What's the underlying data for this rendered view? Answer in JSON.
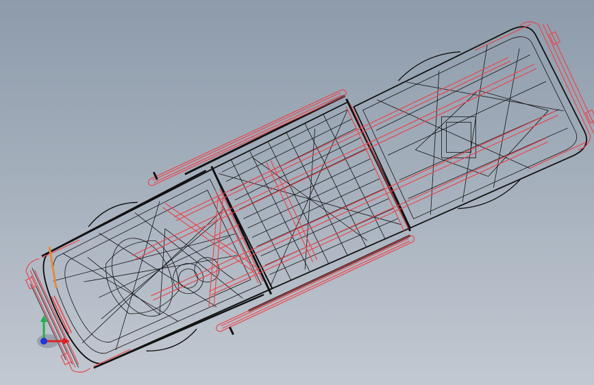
{
  "viewport": {
    "background_top": "#8d9bab",
    "background_bottom": "#c3c9d2",
    "wire_color": "#111111",
    "frame_color": "#e8474c"
  },
  "model": {
    "icon": "vehicle-chassis-wireframe-icon"
  },
  "triad": {
    "x_color": "#e02020",
    "y_color": "#22b04a",
    "z_color": "#2036d8",
    "icon": "axis-triad-icon"
  }
}
